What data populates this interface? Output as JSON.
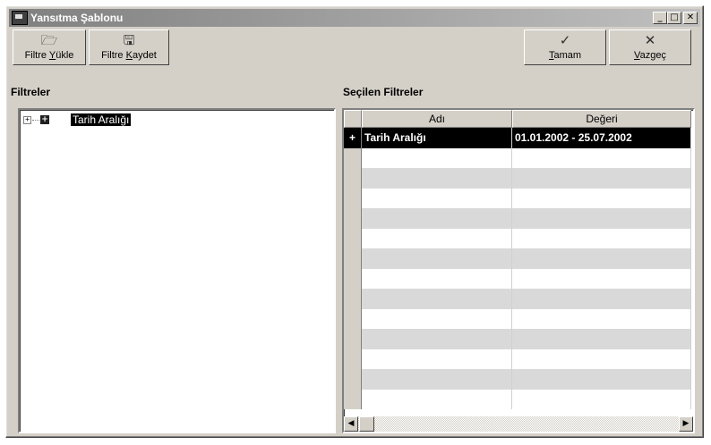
{
  "window": {
    "title": "Yansıtma Şablonu",
    "controls": {
      "minimize": "_",
      "maximize": "□",
      "close": "✕"
    }
  },
  "toolbar": {
    "load": {
      "icon": "open-folder-icon",
      "pre": "Filtre ",
      "key": "Y",
      "post": "ükle"
    },
    "save": {
      "icon": "floppy-disk-icon",
      "pre": "Filtre ",
      "key": "K",
      "post": "aydet"
    },
    "ok": {
      "icon": "checkmark-icon",
      "pre": "",
      "key": "T",
      "post": "amam"
    },
    "cancel": {
      "icon": "cross-tools-icon",
      "pre": "",
      "key": "V",
      "post": "azgeç"
    }
  },
  "filters_panel": {
    "heading": "Filtreler",
    "tree": [
      {
        "label": "Tarih Aralığı",
        "expander": "+",
        "icon": "+"
      }
    ]
  },
  "selected_panel": {
    "heading": "Seçilen Filtreler",
    "columns": [
      "Adı",
      "Değeri"
    ],
    "rows": [
      {
        "indicator": "+",
        "name": "Tarih Aralığı",
        "value": "01.01.2002 - 25.07.2002"
      }
    ]
  },
  "colors": {
    "selection": "#000000",
    "face": "#d4d0c8",
    "alt_row": "#d9d9d9"
  }
}
